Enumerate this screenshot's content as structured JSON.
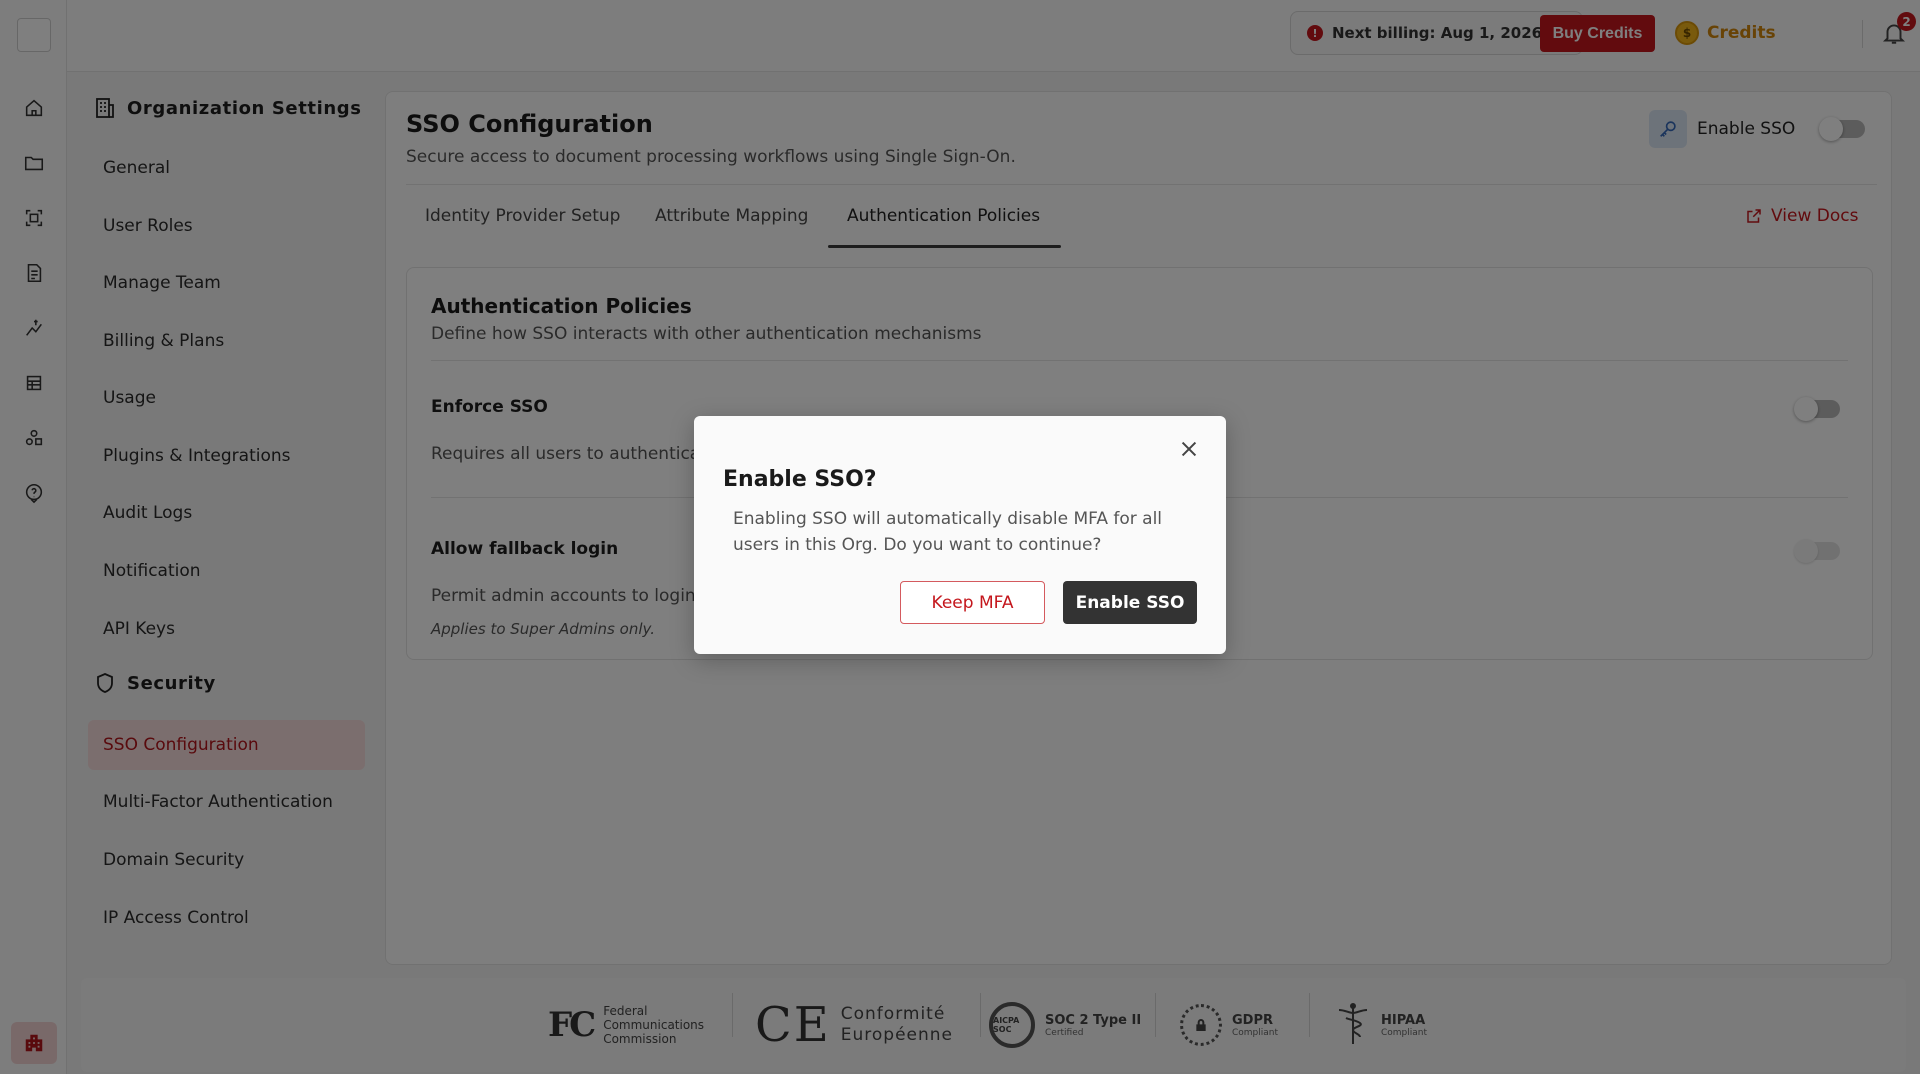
{
  "topbar": {
    "billing_text": "Next billing: Aug 1, 2026",
    "buy_credits_label": "Buy Credits",
    "credits_label": "Credits",
    "credits_coin": "$",
    "notification_count": "2",
    "icons": [
      "alert-icon",
      "coin-icon",
      "bell-icon",
      "help-icon"
    ]
  },
  "rail": {
    "icons": [
      "home-icon",
      "folder-icon",
      "scan-icon",
      "document-icon",
      "workflow-icon",
      "table-icon",
      "shapes-icon",
      "help-icon",
      "organization-icon"
    ]
  },
  "settings_nav": {
    "org_heading": "Organization Settings",
    "org_items": [
      {
        "label": "General"
      },
      {
        "label": "User Roles"
      },
      {
        "label": "Manage Team"
      },
      {
        "label": "Billing & Plans"
      },
      {
        "label": "Usage"
      },
      {
        "label": "Plugins & Integrations"
      },
      {
        "label": "Audit Logs"
      },
      {
        "label": "Notification"
      },
      {
        "label": "API Keys"
      }
    ],
    "security_heading": "Security",
    "security_items": [
      {
        "label": "SSO Configuration",
        "active": true
      },
      {
        "label": "Multi-Factor Authentication"
      },
      {
        "label": "Domain Security"
      },
      {
        "label": "IP Access Control"
      }
    ]
  },
  "main": {
    "title": "SSO Configuration",
    "subtitle": "Secure access to document processing workflows using Single Sign-On.",
    "enable_sso_label": "Enable SSO",
    "enable_sso_on": false,
    "tabs": [
      {
        "label": "Identity Provider Setup"
      },
      {
        "label": "Attribute Mapping"
      },
      {
        "label": "Authentication Policies",
        "active": true
      }
    ],
    "view_docs_label": "View Docs"
  },
  "policies": {
    "title": "Authentication Policies",
    "subtitle": "Define how SSO interacts with other authentication mechanisms",
    "items": [
      {
        "name": "Enforce SSO",
        "description": "Requires all users to authenticate via SSO",
        "enabled": false
      },
      {
        "name": "Allow fallback login",
        "description": "Permit admin accounts to login with password if SSO fails",
        "note": "Applies to Super Admins only.",
        "enabled": false,
        "disabled": true
      }
    ]
  },
  "footer": {
    "fcc_logo": "FC",
    "fcc_text": [
      "Federal",
      "Communications",
      "Commission"
    ],
    "ce_logo": "CE",
    "ce_text": [
      "Conformité",
      "Européenne"
    ],
    "soc_badge": "AICPA SOC",
    "soc_title": "SOC 2 Type II",
    "soc_sub": "Certified",
    "gdpr_title": "GDPR",
    "gdpr_sub": "Compliant",
    "hipaa_title": "HIPAA",
    "hipaa_sub": "Compliant"
  },
  "modal": {
    "title": "Enable SSO?",
    "body": "Enabling SSO will automatically disable MFA for all users in this Org. Do you want to continue?",
    "keep_label": "Keep MFA",
    "enable_label": "Enable SSO"
  },
  "colors": {
    "brand_red": "#c4161c",
    "credits_gold": "#d1870d",
    "active_nav_bg": "#f7dddd",
    "primary_dark": "#333333"
  }
}
